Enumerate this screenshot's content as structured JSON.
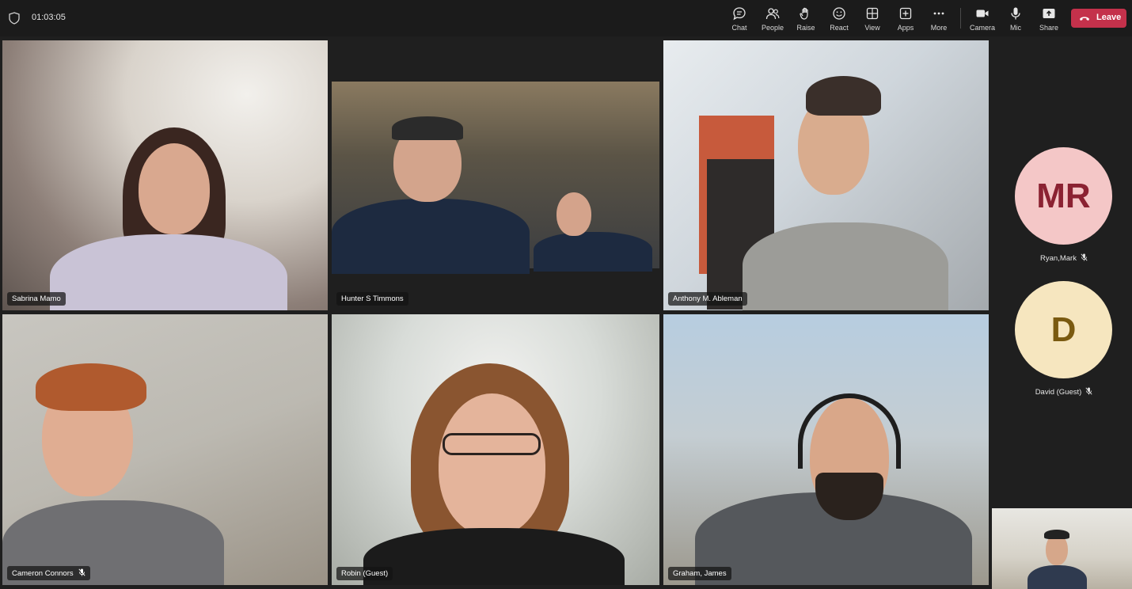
{
  "meeting": {
    "timer": "01:03:05"
  },
  "toolbar": {
    "chat": "Chat",
    "people": "People",
    "raise": "Raise",
    "react": "React",
    "view": "View",
    "apps": "Apps",
    "more": "More",
    "camera": "Camera",
    "mic": "Mic",
    "share": "Share",
    "leave": "Leave"
  },
  "participants": {
    "sabrina": "Sabrina Mamo",
    "hunter": "Hunter S Timmons",
    "anthony": "Anthony M. Ableman",
    "cameron": "Cameron Connors",
    "robin": "Robin (Guest)",
    "graham": "Graham, James"
  },
  "side_participants": [
    {
      "initials": "MR",
      "name": "Ryan,Mark",
      "avatar_color": "#f4c7c7",
      "text_color": "#8b2232"
    },
    {
      "initials": "D",
      "name": "David (Guest)",
      "avatar_color": "#f6e6bf",
      "text_color": "#7a5a10"
    }
  ],
  "colors": {
    "leave_button": "#c4314b",
    "active_speaker_border": "#7f85f5",
    "background": "#1f1f1f"
  }
}
